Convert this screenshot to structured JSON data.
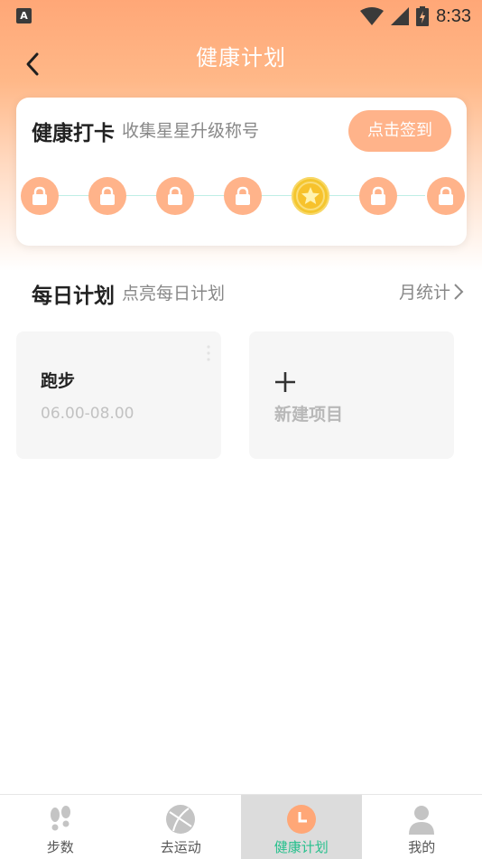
{
  "status_bar": {
    "time": "8:33",
    "app_icon_letter": "A"
  },
  "header": {
    "title": "健康计划"
  },
  "checkin": {
    "title": "健康打卡",
    "subtitle": "收集星星升级称号",
    "button_label": "点击签到",
    "badges": [
      {
        "state": "locked",
        "icon": "lock-icon"
      },
      {
        "state": "locked",
        "icon": "lock-icon"
      },
      {
        "state": "locked",
        "icon": "lock-icon"
      },
      {
        "state": "locked",
        "icon": "lock-icon"
      },
      {
        "state": "current",
        "icon": "star-coin-icon"
      },
      {
        "state": "locked",
        "icon": "lock-icon"
      },
      {
        "state": "locked",
        "icon": "lock-icon"
      }
    ]
  },
  "daily_plan": {
    "title": "每日计划",
    "subtitle": "点亮每日计划",
    "monthly_link": "月统计",
    "items": [
      {
        "name": "跑步",
        "time": "06.00-08.00"
      }
    ],
    "new_item_label": "新建项目"
  },
  "tabbar": {
    "tabs": [
      {
        "label": "步数",
        "icon": "footprints-icon",
        "active": false
      },
      {
        "label": "去运动",
        "icon": "ball-icon",
        "active": false
      },
      {
        "label": "健康计划",
        "icon": "clock-icon",
        "active": true
      },
      {
        "label": "我的",
        "icon": "person-icon",
        "active": false
      }
    ]
  },
  "colors": {
    "accent_orange": "#ffb38a",
    "active_tab_text": "#27c08d",
    "coin_gold": "#f4c62f"
  }
}
